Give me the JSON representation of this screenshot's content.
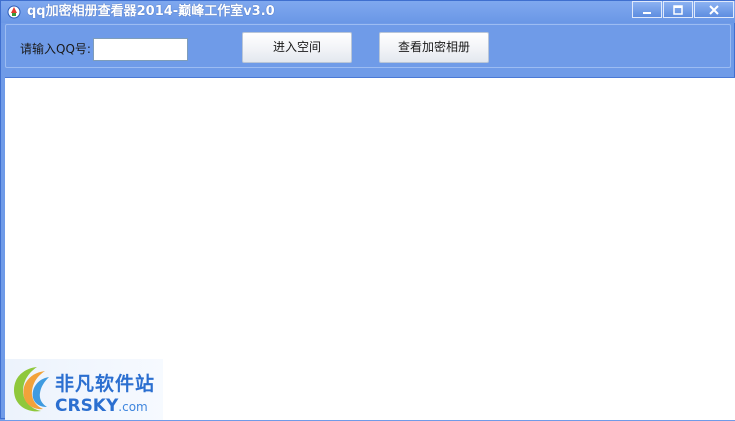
{
  "window": {
    "title": "qq加密相册查看器2014-巅峰工作室v3.0"
  },
  "controls": {
    "qq_label": "请输入QQ号:",
    "qq_value": "",
    "enter_button": "进入空间",
    "view_button": "查看加密相册"
  },
  "watermark": {
    "cn_text": "非凡软件站",
    "en_text": "CRSKY",
    "en_domain": ".com"
  },
  "colors": {
    "window_bg": "#6f9be8",
    "content_bg": "#ffffff",
    "watermark_text": "#2b6fd0"
  }
}
